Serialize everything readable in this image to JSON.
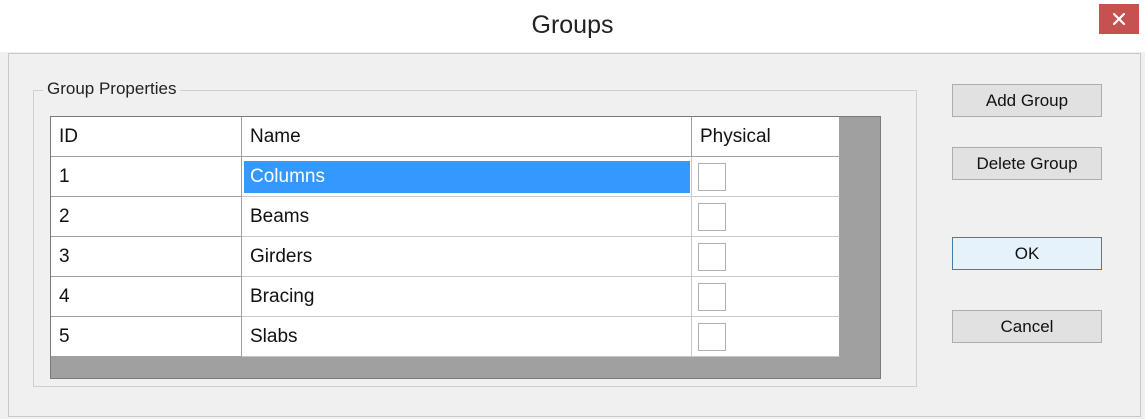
{
  "window": {
    "title": "Groups",
    "close_glyph": "×"
  },
  "group_box": {
    "legend": "Group Properties"
  },
  "table": {
    "columns": [
      "ID",
      "Name",
      "Physical"
    ],
    "rows": [
      {
        "id": "1",
        "name": "Columns",
        "physical": false,
        "selected": true
      },
      {
        "id": "2",
        "name": "Beams",
        "physical": false,
        "selected": false
      },
      {
        "id": "3",
        "name": "Girders",
        "physical": false,
        "selected": false
      },
      {
        "id": "4",
        "name": "Bracing",
        "physical": false,
        "selected": false
      },
      {
        "id": "5",
        "name": "Slabs",
        "physical": false,
        "selected": false
      }
    ]
  },
  "buttons": {
    "add_group": "Add Group",
    "delete_group": "Delete Group",
    "ok": "OK",
    "cancel": "Cancel"
  },
  "colors": {
    "selection": "#3399ff",
    "close_button": "#c75050",
    "dialog_bg": "#f0f0f0"
  }
}
